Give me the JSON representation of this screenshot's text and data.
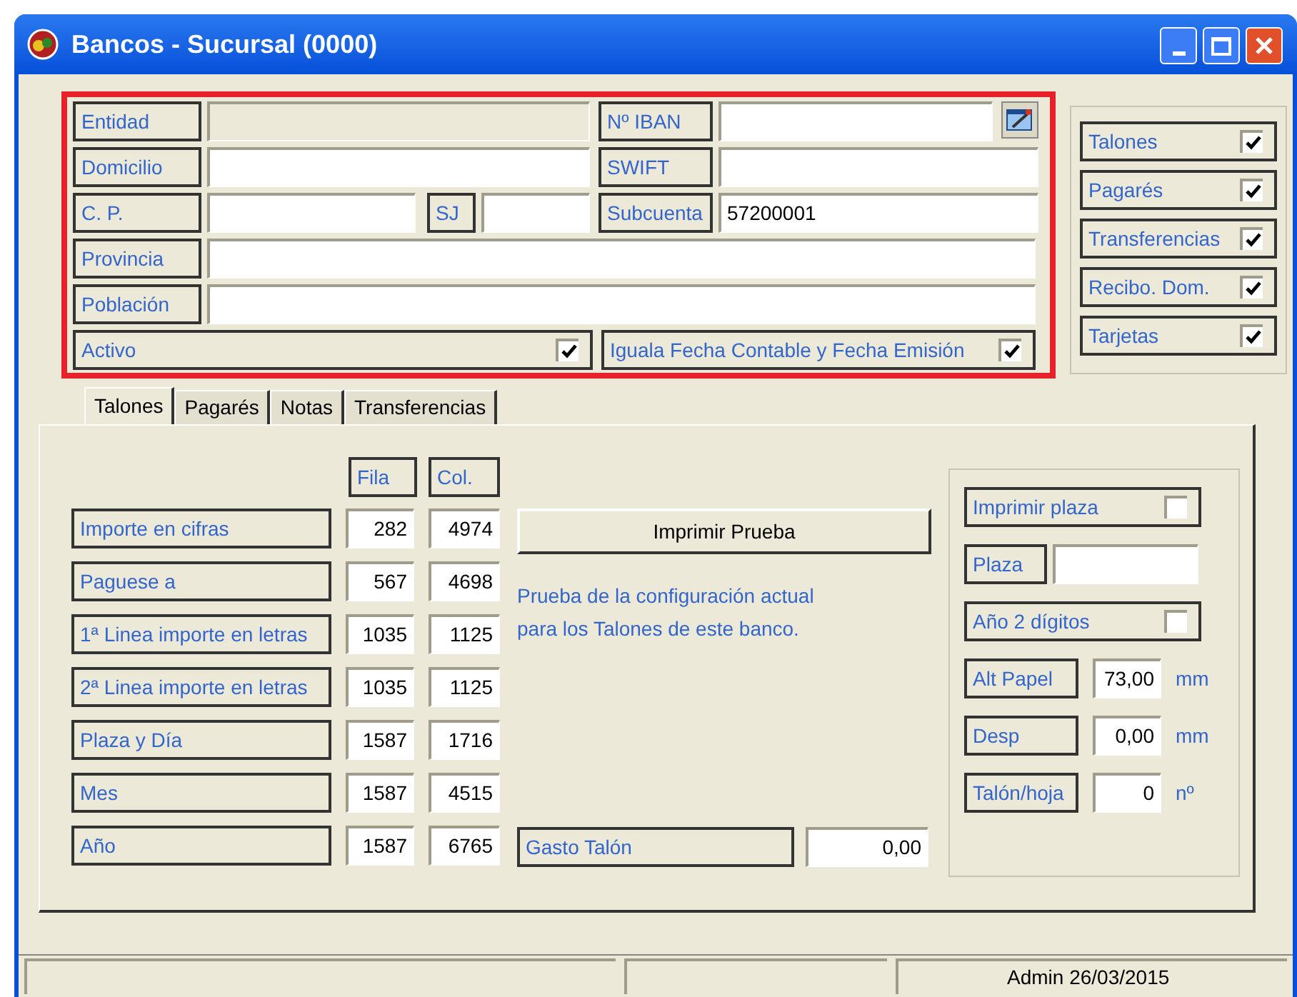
{
  "window": {
    "title": "Bancos - Sucursal (0000)"
  },
  "form": {
    "entidad": {
      "label": "Entidad",
      "disabled": true
    },
    "iban": {
      "label": "Nº IBAN",
      "disabled": false
    },
    "domicilio": {
      "label": "Domicilio",
      "disabled": false
    },
    "swift": {
      "label": "SWIFT",
      "disabled": false
    },
    "cp": {
      "label": "C. P.",
      "disabled": false
    },
    "sj": {
      "label": "SJ",
      "disabled": false
    },
    "subcuenta": {
      "label": "Subcuenta",
      "value": "57200001",
      "disabled": false
    },
    "provincia": {
      "label": "Provincia",
      "disabled": false
    },
    "poblacion": {
      "label": "Población",
      "disabled": false
    },
    "activo": {
      "label": "Activo",
      "checked": true
    },
    "iguala": {
      "label": "Iguala Fecha Contable y Fecha Emisión",
      "checked": true
    }
  },
  "document_types": [
    {
      "label": "Talones",
      "checked": true
    },
    {
      "label": "Pagarés",
      "checked": true
    },
    {
      "label": "Transferencias",
      "checked": true
    },
    {
      "label": "Recibo. Dom.",
      "checked": true
    },
    {
      "label": "Tarjetas",
      "checked": true
    }
  ],
  "tabs": [
    {
      "label": "Talones",
      "selected": true
    },
    {
      "label": "Pagarés",
      "selected": false
    },
    {
      "label": "Notas",
      "selected": false
    },
    {
      "label": "Transferencias",
      "selected": false
    }
  ],
  "talones": {
    "column_headers": [
      "Fila",
      "Col."
    ],
    "rows": [
      {
        "label": "Importe en cifras",
        "fila": "282",
        "col": "4974"
      },
      {
        "label": "Paguese a",
        "fila": "567",
        "col": "4698"
      },
      {
        "label": "1ª Linea importe en letras",
        "fila": "1035",
        "col": "1125"
      },
      {
        "label": "2ª Linea importe en letras",
        "fila": "1035",
        "col": "1125"
      },
      {
        "label": "Plaza y Día",
        "fila": "1587",
        "col": "1716"
      },
      {
        "label": "Mes",
        "fila": "1587",
        "col": "4515"
      },
      {
        "label": "Año",
        "fila": "1587",
        "col": "6765"
      }
    ],
    "print_button": "Imprimir Prueba",
    "description": "Prueba de la configuración actual para los Talones de este banco.",
    "gasto": {
      "label": "Gasto Talón",
      "value": "0,00"
    },
    "options": {
      "imprimir_plaza": {
        "label": "Imprimir plaza",
        "checked": false
      },
      "plaza": {
        "label": "Plaza"
      },
      "anio_2_digitos": {
        "label": "Año 2 dígitos",
        "checked": false
      },
      "alt_papel": {
        "label": "Alt Papel",
        "value": "73,00",
        "unit": "mm"
      },
      "desp": {
        "label": "Desp",
        "value": "0,00",
        "unit": "mm"
      },
      "talon_hoja": {
        "label": "Talón/hoja",
        "value": "0",
        "unit": "nº"
      }
    }
  },
  "status_bar": {
    "text": "Admin 26/03/2015"
  }
}
